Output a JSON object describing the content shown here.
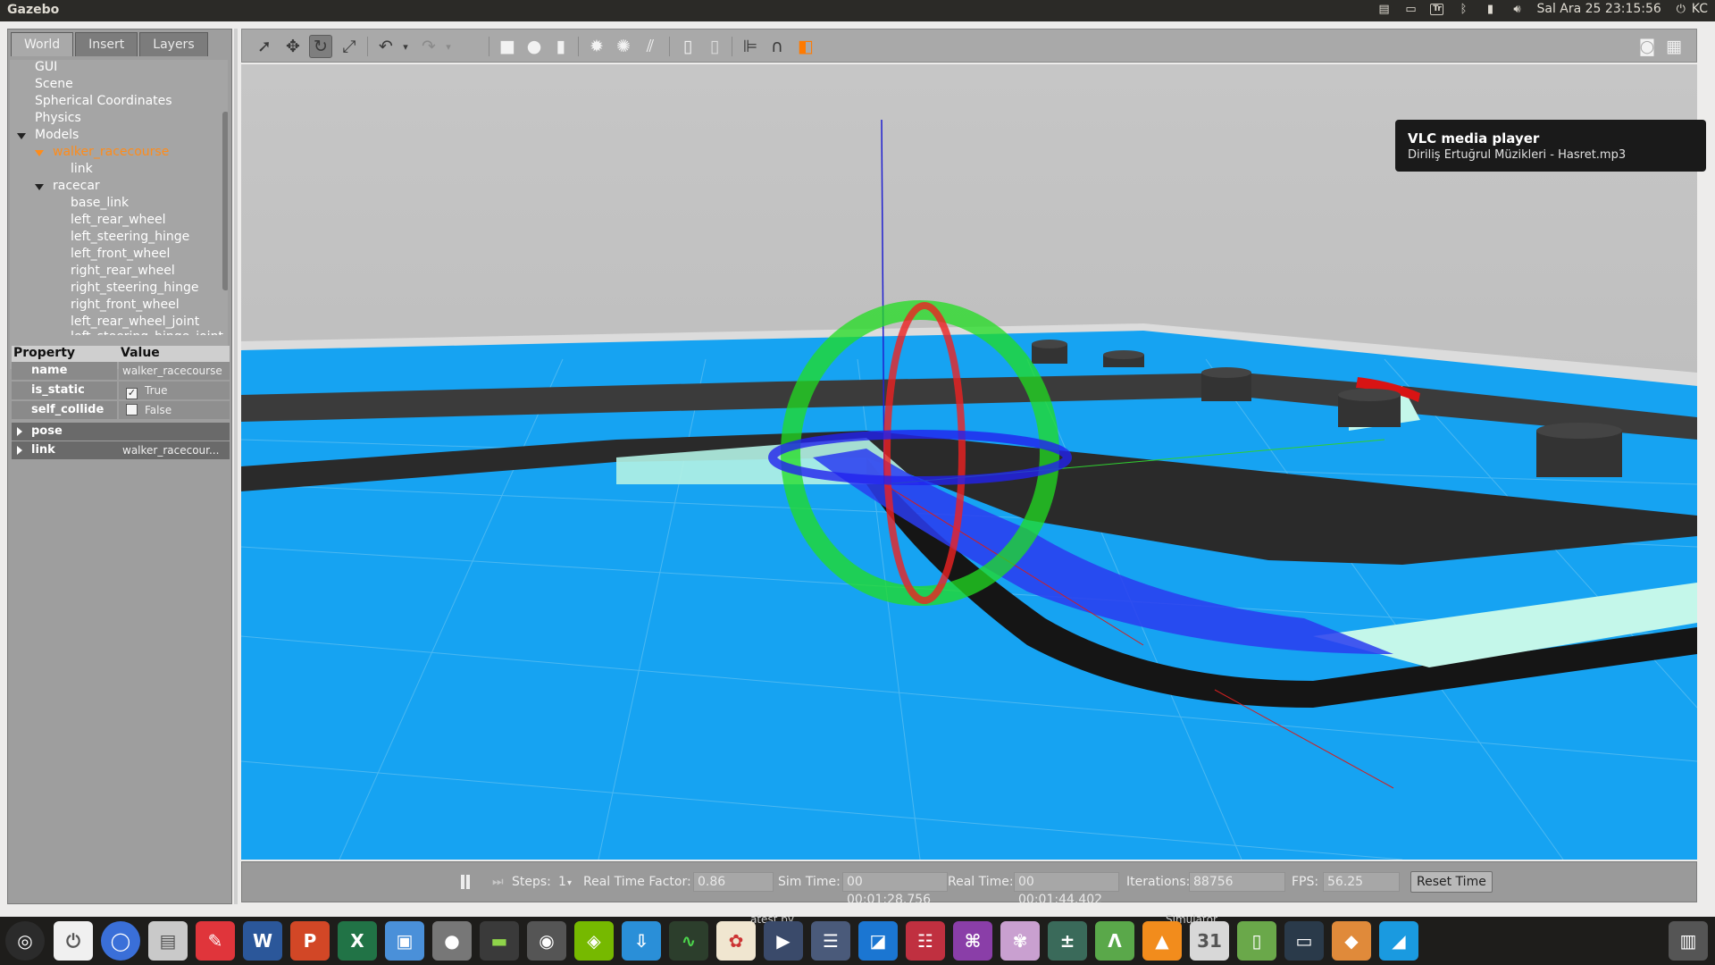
{
  "topbar": {
    "app_title": "Gazebo",
    "tray_icons": [
      "note-icon",
      "screen-share-icon",
      "keyboard-layout-icon",
      "bluetooth-icon",
      "battery-icon",
      "volume-icon"
    ],
    "keyboard_label": "Tr",
    "datetime": "Sal Ara 25 23:15:56",
    "power_icon": "power-icon",
    "user": "KC"
  },
  "left_panel": {
    "tabs": [
      "World",
      "Insert",
      "Layers"
    ],
    "active_tab": "World",
    "tree": {
      "gui": "GUI",
      "scene": "Scene",
      "spherical": "Spherical Coordinates",
      "physics": "Physics",
      "models": "Models",
      "walker": "walker_racecourse",
      "walker_link": "link",
      "racecar": "racecar",
      "racecar_children": [
        "base_link",
        "left_rear_wheel",
        "left_steering_hinge",
        "left_front_wheel",
        "right_rear_wheel",
        "right_steering_hinge",
        "right_front_wheel",
        "left_rear_wheel_joint"
      ],
      "partial_row": "left_steering_hinge_joint"
    },
    "properties": {
      "header_property": "Property",
      "header_value": "Value",
      "name_key": "name",
      "name_value": "walker_racecourse",
      "is_static_key": "is_static",
      "is_static_value": "True",
      "self_collide_key": "self_collide",
      "self_collide_value": "False",
      "pose_key": "pose",
      "link_key": "link",
      "link_value": "walker_racecour..."
    }
  },
  "toolbar": {
    "tools": [
      "select-arrow-icon",
      "translate-icon",
      "rotate-icon",
      "scale-icon",
      "undo-icon",
      "undo-menu-icon",
      "redo-icon",
      "redo-menu-icon",
      "box-icon",
      "sphere-icon",
      "cylinder-icon",
      "point-light-icon",
      "spot-light-icon",
      "directional-light-icon",
      "copy-icon",
      "paste-icon",
      "align-icon",
      "snap-icon",
      "view-angle-icon",
      "screenshot-icon",
      "log-icon"
    ],
    "active_tool": "rotate-icon"
  },
  "notification": {
    "title": "VLC media player",
    "body": "Diriliş Ertuğrul Müzikleri - Hasret.mp3"
  },
  "statusbar": {
    "steps_label": "Steps:",
    "steps_value": "1",
    "rtf_label": "Real Time Factor:",
    "rtf_value": "0.86",
    "sim_time_label": "Sim Time:",
    "sim_time_value": "00 00:01:28.756",
    "real_time_label": "Real Time:",
    "real_time_value": "00 00:01:44.402",
    "iterations_label": "Iterations:",
    "iterations_value": "88756",
    "fps_label": "FPS:",
    "fps_value": "56.25",
    "reset_label": "Reset Time"
  },
  "dock": {
    "labels": {
      "latest": "atest.py",
      "simulator": "Simulator"
    },
    "apps": [
      "ubuntu-icon",
      "power-icon",
      "chromium-icon",
      "files-icon",
      "pdf-editor-icon",
      "word-icon",
      "powerpoint-icon",
      "excel-icon",
      "file-manager-icon",
      "disc-icon",
      "terminal-green-icon",
      "webcam-icon",
      "nvidia-icon",
      "download-icon",
      "system-monitor-icon",
      "paint-icon",
      "video-player-icon",
      "settings-icon",
      "remote-desktop-icon",
      "control-panel-icon",
      "web-browser-icon",
      "photo-icon",
      "calculator-icon",
      "android-studio-icon",
      "vlc-icon",
      "calendar-icon",
      "tablet-icon",
      "terminal-icon",
      "gazebo-icon",
      "drive-icon",
      "trash-icon"
    ]
  }
}
